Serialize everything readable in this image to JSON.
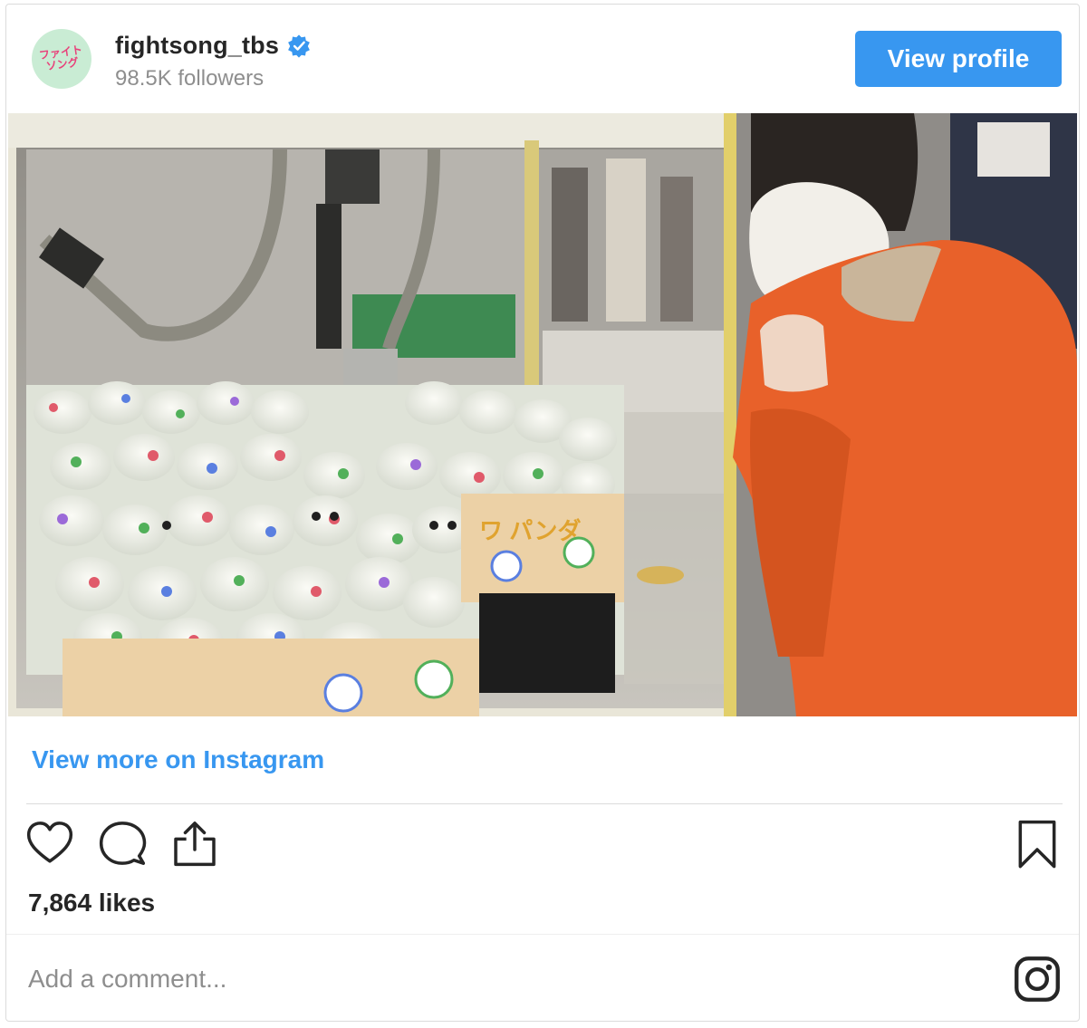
{
  "header": {
    "avatar_line1": "ファイト",
    "avatar_line2": "ソング",
    "username": "fightsong_tbs",
    "followers": "98.5K followers",
    "view_profile_label": "View profile"
  },
  "media": {
    "sign_text": "ワ パンダ"
  },
  "post": {
    "view_more_label": "View more on Instagram",
    "likes": "7,864 likes",
    "comment_placeholder": "Add a comment..."
  },
  "colors": {
    "accent": "#3897f0",
    "coat": "#e8612a",
    "avatar_bg": "#c9ecd4"
  },
  "icons": [
    "verified-badge-icon",
    "heart-icon",
    "comment-icon",
    "share-icon",
    "bookmark-icon",
    "instagram-icon"
  ]
}
